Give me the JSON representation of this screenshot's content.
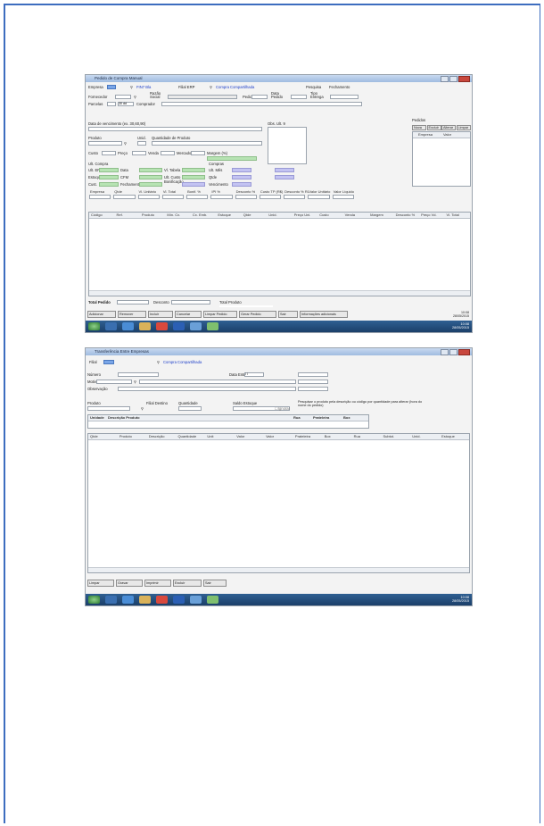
{
  "screen1": {
    "window_title": "Pedido de Compra Manual",
    "empresa_label": "Empresa",
    "filial_value": "FIN7 Bla",
    "filial_label": "Filial ERP",
    "fornecedor_value": "Compra Compartilhada",
    "btn_pesquisa": "Pesquisa",
    "btn_fechamento": "Fechamento",
    "fornecedor_label": "Fornecedor",
    "razao_social_label": "Razão Social",
    "pedido_label": "Pedido",
    "data_pedido_label": "Data Pedido",
    "tipo_entrega_label": "Tipo Entrega",
    "parcelas_label": "Parcelas",
    "prazo_value": "30 dd",
    "comprador_label": "Comprador",
    "data_vencimento_label": "Data de vencimento (ex. 30,60,90)",
    "obs_label": "Obs. Ult. 9",
    "produto_label": "Produto",
    "unid_label": "Unid.",
    "quantidade_produto_label": "Quantidade de Produto",
    "custo_label": "Custo",
    "preco_label": "Preço",
    "venda_label": "Venda",
    "mercado_label": "Mercado",
    "margem_label": "Margem (%)",
    "ult_compra_label": "Ult. Compra",
    "compras_label": "Compras",
    "ult_ep_label": "Ult. EP",
    "data_label": "Data",
    "vl_tabela_label": "Vl. Tabela",
    "ult_mes_label": "Ult. Mês",
    "estoque_label": "Estoque",
    "cfm_label": "CFM",
    "ult_custo_label": "Ult. Custo",
    "qtde_label": "Qtde",
    "cust_label": "Cust.",
    "fechamento_label": "Fechamento",
    "bonificacao_label": "Bonificação",
    "vencimento_label": "Vencimento",
    "right_panel_title": "Pedidos",
    "right_col_empresa": "Empresa",
    "right_col_valor": "Valor",
    "right_tabs": [
      "Nova",
      "Excluir",
      "Alterar",
      "Limpar"
    ],
    "row_headers": [
      "Empresa",
      "Qtde",
      "Vl. Unitário",
      "Vl. Total",
      "Bonif. %",
      "IPI %",
      "Desconto %",
      "Custo TP (R$)",
      "Desconto % RL",
      "Valor Unitário",
      "Valor Líquido"
    ],
    "grid_headers": [
      "Código",
      "Ref.",
      "Produto",
      "Mín. Cx.",
      "Cx. Emb.",
      "Estoque",
      "Qtde",
      "Unid.",
      "Preço Uni.",
      "Custo",
      "Venda",
      "Margem",
      "Desconto %",
      "Preço Vd.",
      "Vl. Total"
    ],
    "total_pedido_label": "Total Pedido",
    "desconto_label": "Desconto",
    "total_produto_label": "Total Produto",
    "buttons": [
      "Adicionar",
      "Remover",
      "Incluir",
      "Cancelar",
      "Limpar Pedido",
      "Gerar Pedido",
      "Sair",
      "Informações adicionais"
    ],
    "tray_time": "10:08",
    "tray_date": "28/05/2015"
  },
  "screen2": {
    "window_title": "Transferência Entre Empresas",
    "filial_label": "Filial",
    "filial_value": "Compra Compartilhada",
    "numero_label": "Número",
    "data_entrada_label": "Data Entrada",
    "data_entrada_value": "/ /",
    "motivo_label": "Motivo",
    "observacao_label": "Observação",
    "produto_label": "Produto",
    "filial_destino_label": "Filial Destino",
    "quantidade_label": "Quantidade",
    "saldo_estoque_label": "Saldo Estoque",
    "ignorar_label": "Ignorar",
    "note": "Pesquisar o produto pela descrição ou código por quantidade para alterar (hora do nome do pedido)",
    "table_headers": [
      "Unidade",
      "Descrição Produto",
      "Rua",
      "Prateleira",
      "Box"
    ],
    "grid_headers": [
      "Qtde",
      "Produto",
      "Descrição",
      "Quantidade",
      "Unit",
      "Valor",
      "Valor",
      "Prateleira",
      "Box",
      "Rua",
      "Subtot.",
      "Unid.",
      "Estoque"
    ],
    "buttons": [
      "Limpar",
      "Gravar",
      "Imprimir",
      "Excluir",
      "Sair"
    ],
    "tray_time": "10:08",
    "tray_date": "28/05/2015"
  },
  "colors": {
    "frame_border": "#3d6dbf",
    "field_green": "#b7e3b3",
    "field_purple": "#c3c3f2",
    "taskbar": "#1b3f69",
    "titlebar": "#9fbbe0"
  }
}
